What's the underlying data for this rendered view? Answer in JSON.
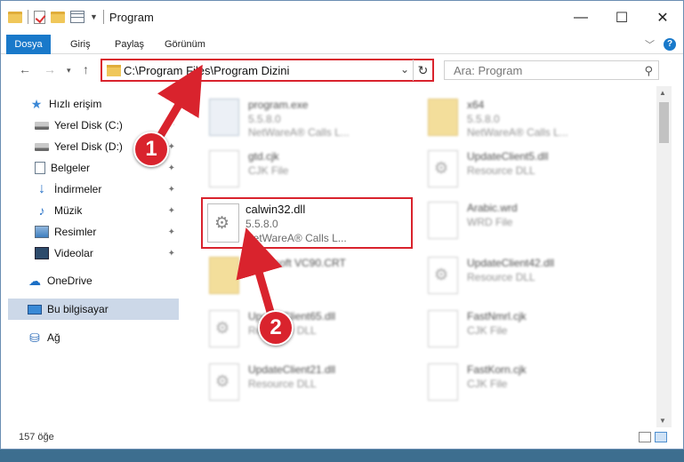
{
  "window": {
    "title": "Program",
    "controls": {
      "minimize": "—",
      "maximize": "☐",
      "close": "✕"
    }
  },
  "ribbon": {
    "tabs": [
      "Dosya",
      "Giriş",
      "Paylaş",
      "Görünüm"
    ]
  },
  "nav": {
    "address": "C:\\Program Files\\Program Dizini",
    "search_placeholder": "Ara: Program"
  },
  "sidebar": {
    "items": [
      {
        "label": "Hızlı erişim",
        "icon": "star-icon"
      },
      {
        "label": "Yerel Disk (C:)",
        "icon": "disk-icon",
        "pinned": true
      },
      {
        "label": "Yerel Disk (D:)",
        "icon": "disk-icon",
        "pinned": true
      },
      {
        "label": "Belgeler",
        "icon": "documents-icon",
        "pinned": true
      },
      {
        "label": "İndirmeler",
        "icon": "download-icon",
        "pinned": true
      },
      {
        "label": "Müzik",
        "icon": "music-icon",
        "pinned": true
      },
      {
        "label": "Resimler",
        "icon": "pictures-icon",
        "pinned": true
      },
      {
        "label": "Videolar",
        "icon": "videos-icon",
        "pinned": true
      },
      {
        "label": "OneDrive",
        "icon": "onedrive-icon"
      },
      {
        "label": "Bu bilgisayar",
        "icon": "computer-icon",
        "selected": true
      },
      {
        "label": "Ağ",
        "icon": "network-icon"
      }
    ]
  },
  "files": [
    {
      "name": "program.exe",
      "line2": "5.5.8.0",
      "line3": "NetWareA® Calls L..."
    },
    {
      "name": "x64",
      "line2": "5.5.8.0",
      "line3": "NetWareA® Calls L..."
    },
    {
      "name": "gtd.cjk",
      "line2": "CJK File",
      "line3": ""
    },
    {
      "name": "UpdateClient5.dll",
      "line2": "Resource DLL",
      "line3": ""
    },
    {
      "name": "calwin32.dll",
      "line2": "5.5.8.0",
      "line3": "NetWareA® Calls L..."
    },
    {
      "name": "Arabic.wrd",
      "line2": "WRD File",
      "line3": ""
    },
    {
      "name": "Microsoft VC90.CRT",
      "line2": "",
      "line3": ""
    },
    {
      "name": "UpdateClient42.dll",
      "line2": "Resource DLL",
      "line3": ""
    },
    {
      "name": "UpdateClient65.dll",
      "line2": "Resource DLL",
      "line3": ""
    },
    {
      "name": "FastNmrl.cjk",
      "line2": "CJK File",
      "line3": ""
    },
    {
      "name": "UpdateClient21.dll",
      "line2": "Resource DLL",
      "line3": ""
    },
    {
      "name": "FastKorn.cjk",
      "line2": "CJK File",
      "line3": ""
    }
  ],
  "status": {
    "item_count": "157 öğe"
  },
  "annotations": {
    "step1": "1",
    "step2": "2",
    "color": "#d9232d"
  }
}
